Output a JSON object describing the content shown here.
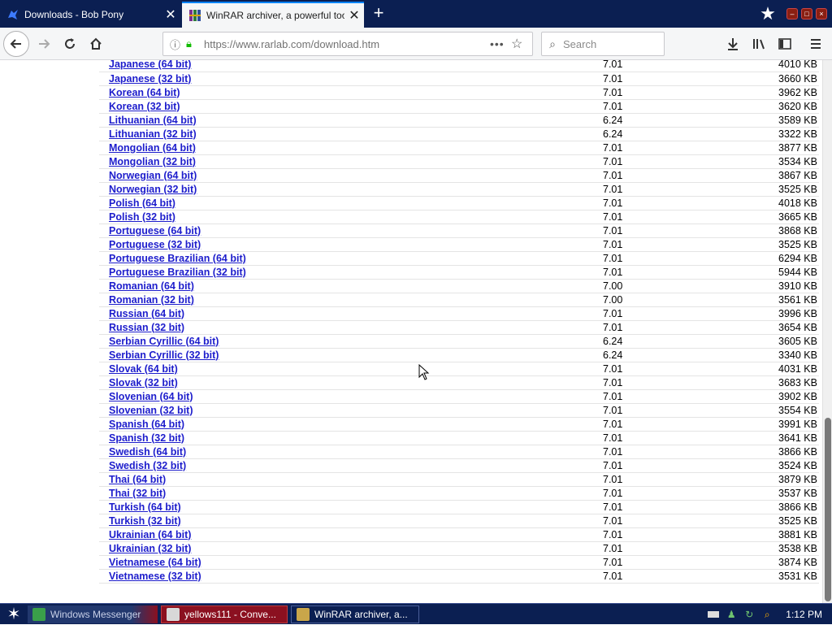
{
  "browser": {
    "tabs": [
      {
        "title": "Downloads - Bob Pony",
        "close": "✕"
      },
      {
        "title": "WinRAR archiver, a powerful tool",
        "close": "✕"
      }
    ],
    "new_tab": "+",
    "url": "https://www.rarlab.com/download.htm",
    "search_placeholder": "Search"
  },
  "downloads": [
    {
      "language": "Japanese (64 bit)",
      "version": "7.01",
      "size": "4010 KB"
    },
    {
      "language": "Japanese (32 bit)",
      "version": "7.01",
      "size": "3660 KB"
    },
    {
      "language": "Korean (64 bit)",
      "version": "7.01",
      "size": "3962 KB"
    },
    {
      "language": "Korean (32 bit)",
      "version": "7.01",
      "size": "3620 KB"
    },
    {
      "language": "Lithuanian (64 bit)",
      "version": "6.24",
      "size": "3589 KB"
    },
    {
      "language": "Lithuanian (32 bit)",
      "version": "6.24",
      "size": "3322 KB"
    },
    {
      "language": "Mongolian (64 bit)",
      "version": "7.01",
      "size": "3877 KB"
    },
    {
      "language": "Mongolian (32 bit)",
      "version": "7.01",
      "size": "3534 KB"
    },
    {
      "language": "Norwegian (64 bit)",
      "version": "7.01",
      "size": "3867 KB"
    },
    {
      "language": "Norwegian (32 bit)",
      "version": "7.01",
      "size": "3525 KB"
    },
    {
      "language": "Polish (64 bit)",
      "version": "7.01",
      "size": "4018 KB"
    },
    {
      "language": "Polish (32 bit)",
      "version": "7.01",
      "size": "3665 KB"
    },
    {
      "language": "Portuguese (64 bit)",
      "version": "7.01",
      "size": "3868 KB"
    },
    {
      "language": "Portuguese (32 bit)",
      "version": "7.01",
      "size": "3525 KB"
    },
    {
      "language": "Portuguese Brazilian (64 bit)",
      "version": "7.01",
      "size": "6294 KB"
    },
    {
      "language": "Portuguese Brazilian (32 bit)",
      "version": "7.01",
      "size": "5944 KB"
    },
    {
      "language": "Romanian (64 bit)",
      "version": "7.00",
      "size": "3910 KB"
    },
    {
      "language": "Romanian (32 bit)",
      "version": "7.00",
      "size": "3561 KB"
    },
    {
      "language": "Russian (64 bit)",
      "version": "7.01",
      "size": "3996 KB"
    },
    {
      "language": "Russian (32 bit)",
      "version": "7.01",
      "size": "3654 KB"
    },
    {
      "language": "Serbian Cyrillic (64 bit)",
      "version": "6.24",
      "size": "3605 KB"
    },
    {
      "language": "Serbian Cyrillic (32 bit)",
      "version": "6.24",
      "size": "3340 KB"
    },
    {
      "language": "Slovak (64 bit)",
      "version": "7.01",
      "size": "4031 KB"
    },
    {
      "language": "Slovak (32 bit)",
      "version": "7.01",
      "size": "3683 KB"
    },
    {
      "language": "Slovenian (64 bit)",
      "version": "7.01",
      "size": "3902 KB"
    },
    {
      "language": "Slovenian (32 bit)",
      "version": "7.01",
      "size": "3554 KB"
    },
    {
      "language": "Spanish (64 bit)",
      "version": "7.01",
      "size": "3991 KB"
    },
    {
      "language": "Spanish (32 bit)",
      "version": "7.01",
      "size": "3641 KB"
    },
    {
      "language": "Swedish (64 bit)",
      "version": "7.01",
      "size": "3866 KB"
    },
    {
      "language": "Swedish (32 bit)",
      "version": "7.01",
      "size": "3524 KB"
    },
    {
      "language": "Thai (64 bit)",
      "version": "7.01",
      "size": "3879 KB"
    },
    {
      "language": "Thai (32 bit)",
      "version": "7.01",
      "size": "3537 KB"
    },
    {
      "language": "Turkish (64 bit)",
      "version": "7.01",
      "size": "3866 KB"
    },
    {
      "language": "Turkish (32 bit)",
      "version": "7.01",
      "size": "3525 KB"
    },
    {
      "language": "Ukrainian (64 bit)",
      "version": "7.01",
      "size": "3881 KB"
    },
    {
      "language": "Ukrainian (32 bit)",
      "version": "7.01",
      "size": "3538 KB"
    },
    {
      "language": "Vietnamese (64 bit)",
      "version": "7.01",
      "size": "3874 KB"
    },
    {
      "language": "Vietnamese (32 bit)",
      "version": "7.01",
      "size": "3531 KB"
    }
  ],
  "taskbar": {
    "items": [
      {
        "label": "Windows Messenger"
      },
      {
        "label": "yellows111 - Conve..."
      },
      {
        "label": "WinRAR archiver, a..."
      }
    ],
    "clock": "1:12 PM"
  },
  "colors": {
    "link": "#1d1dcc",
    "tabstrip": "#0b1f52",
    "taskbar": "#0b1f52",
    "active_task": "#8b1020"
  }
}
